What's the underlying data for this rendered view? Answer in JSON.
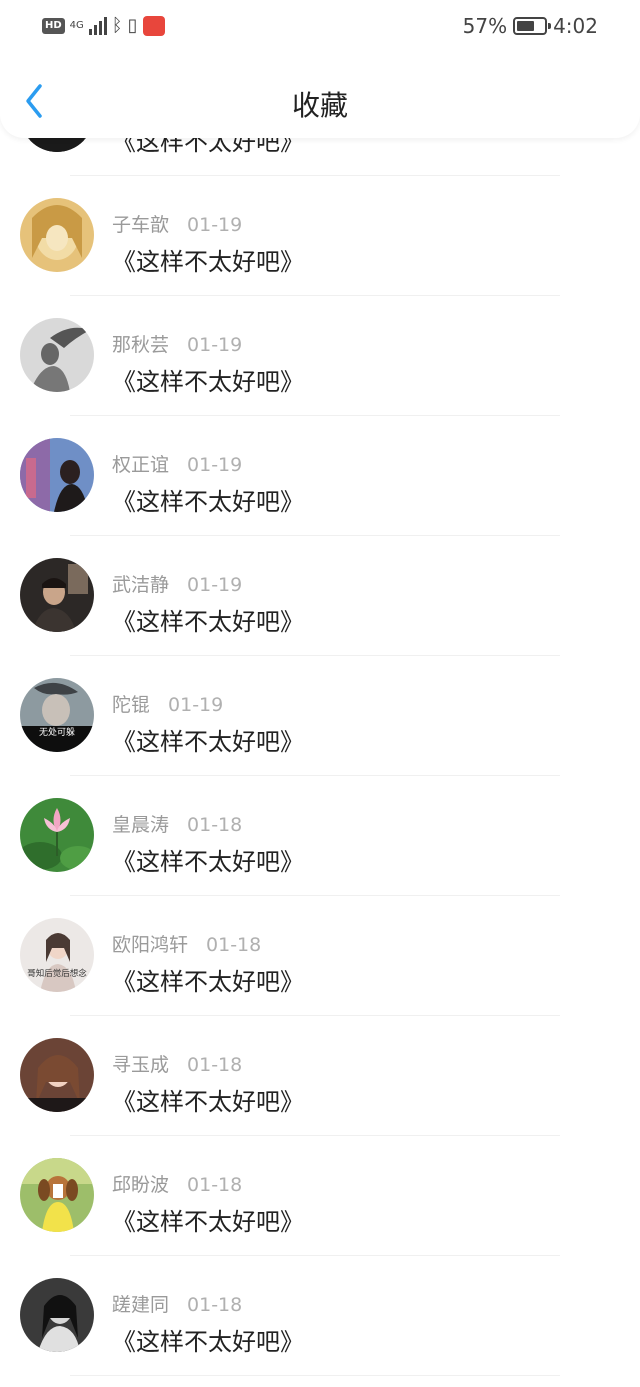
{
  "status_bar": {
    "hd": "HD",
    "network": "4G",
    "battery_text": "57%",
    "battery_level": 0.57,
    "time": "4:02"
  },
  "header": {
    "title": "收藏",
    "back_icon": "chevron-left-icon",
    "accent_color": "#2b9cf0"
  },
  "items": [
    {
      "name": "",
      "date": "",
      "title": "《这样不太好吧》",
      "avatar": "dark-portrait"
    },
    {
      "name": "子车歆",
      "date": "01-19",
      "title": "《这样不太好吧》",
      "avatar": "anime-girl-gold"
    },
    {
      "name": "那秋芸",
      "date": "01-19",
      "title": "《这样不太好吧》",
      "avatar": "bw-windblown-hair"
    },
    {
      "name": "权正谊",
      "date": "01-19",
      "title": "《这样不太好吧》",
      "avatar": "city-girl"
    },
    {
      "name": "武洁静",
      "date": "01-19",
      "title": "《这样不太好吧》",
      "avatar": "dark-room-person"
    },
    {
      "name": "陀锟",
      "date": "01-19",
      "title": "《这样不太好吧》",
      "avatar": "smoke-portrait",
      "avatar_caption": "无处可躲"
    },
    {
      "name": "皇晨涛",
      "date": "01-18",
      "title": "《这样不太好吧》",
      "avatar": "lotus-flower"
    },
    {
      "name": "欧阳鸿轩",
      "date": "01-18",
      "title": "《这样不太好吧》",
      "avatar": "girl-with-caption",
      "avatar_caption": "哥知后觉后想念"
    },
    {
      "name": "寻玉成",
      "date": "01-18",
      "title": "《这样不太好吧》",
      "avatar": "brown-hair-girl"
    },
    {
      "name": "邱盼波",
      "date": "01-18",
      "title": "《这样不太好吧》",
      "avatar": "beagle-dog"
    },
    {
      "name": "蹉建同",
      "date": "01-18",
      "title": "《这样不太好吧》",
      "avatar": "bw-girl"
    }
  ]
}
